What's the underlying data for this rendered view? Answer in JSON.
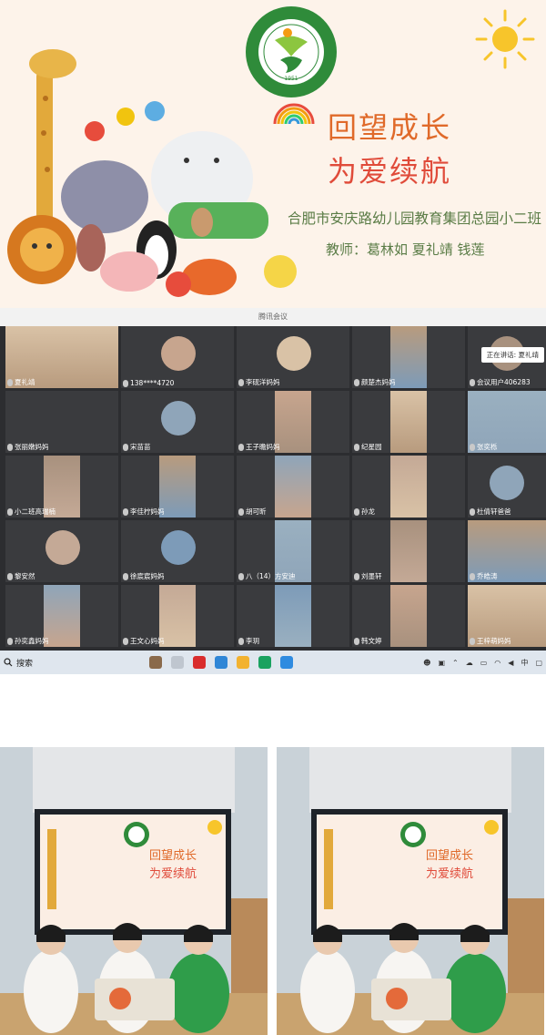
{
  "banner": {
    "title_line1": "回望成长",
    "title_line2": "为爱续航",
    "school": "合肥市安庆路幼儿园教育集团总园小二班",
    "teachers": "教师：葛林如  夏礼靖  钱莲",
    "logo": {
      "ring_text": "合肥市安庆路幼儿园教育集团",
      "ring_text_en": "Anqing Road Kindergarten in Hefei Education Group",
      "year": "1951"
    },
    "colors": {
      "title_orange": "#e06a2a",
      "title_red": "#e04b3a",
      "title_green": "#4f9d3c",
      "text_green": "#5a7c46"
    }
  },
  "meeting": {
    "window_title": "腾讯会议",
    "speaking_label": "正在讲话: 夏礼靖",
    "participants": [
      "夏礼靖",
      "138****4720",
      "李砚洋妈妈",
      "颜楚杰妈妈",
      "会议用户406283",
      "张丽嫩妈妈",
      "宋苗苗",
      "王子瞻妈妈",
      "纪星园",
      "张奕栎",
      "小二班高瑞楠",
      "李佳柠妈妈",
      "胡可昕",
      "孙龙",
      "杜倩轩爸爸",
      "黎安然",
      "徐宸宸妈妈",
      "八（14）方安迪",
      "刘墨轩",
      "乔皓涛",
      "孙奕鑫妈妈",
      "王文心妈妈",
      "李玥",
      "韩文婷",
      "王梓萌妈妈"
    ],
    "taskbar": {
      "search_label": "搜索",
      "ime_label": "中"
    }
  },
  "photos": [
    {
      "board_title1": "回望成长",
      "board_title2": "为爱续航"
    },
    {
      "board_title1": "回望成长",
      "board_title2": "为爱续航"
    }
  ]
}
